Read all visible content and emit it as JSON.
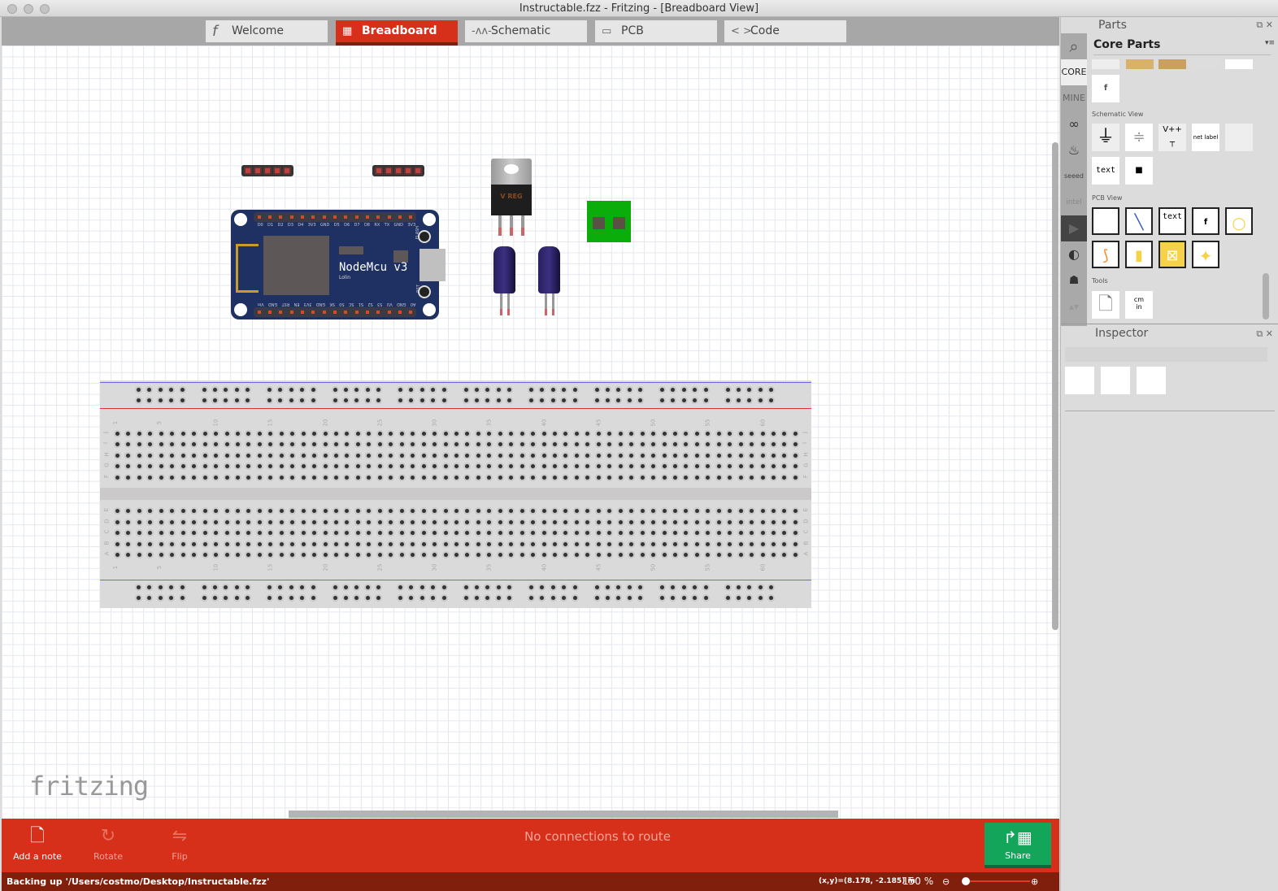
{
  "window": {
    "title": "Instructable.fzz - Fritzing - [Breadboard View]"
  },
  "tabs": [
    {
      "label": "Welcome",
      "icon": "fritzing-f-icon"
    },
    {
      "label": "Breadboard",
      "icon": "breadboard-icon",
      "active": true
    },
    {
      "label": "Schematic",
      "icon": "resistor-icon"
    },
    {
      "label": "PCB",
      "icon": "pcb-icon"
    },
    {
      "label": "Code",
      "icon": "code-icon"
    }
  ],
  "canvas": {
    "logo": "fritzing",
    "nodemcu": {
      "title": "NodeMcu v3",
      "subtitle": "Lolin",
      "flash": "FLASH",
      "rst": "RST",
      "top_pins": [
        "D0",
        "D1",
        "D2",
        "D3",
        "D4",
        "3V3",
        "GND",
        "D5",
        "D6",
        "D7",
        "D8",
        "RX",
        "TX",
        "GND",
        "3V3"
      ],
      "bottom_pins": [
        "A0",
        "GND",
        "VU",
        "S3",
        "S2",
        "S1",
        "SC",
        "S0",
        "SK",
        "GND",
        "3V3",
        "EN",
        "RST",
        "GND",
        "Vin"
      ]
    },
    "regulator_label": "V REG",
    "breadboard": {
      "top_rows": [
        "J",
        "I",
        "H",
        "G",
        "F"
      ],
      "bottom_rows": [
        "E",
        "D",
        "C",
        "B",
        "A"
      ],
      "column_labels": [
        "1",
        "5",
        "10",
        "15",
        "20",
        "25",
        "30",
        "35",
        "40",
        "45",
        "50",
        "55",
        "60"
      ]
    }
  },
  "toolbar": {
    "add_note": "Add a note",
    "rotate": "Rotate",
    "flip": "Flip",
    "routing_status": "No connections to route",
    "share": "Share"
  },
  "statusbar": {
    "message": "Backing up '/Users/costmo/Desktop/Instructable.fzz'",
    "coords": "(x,y)=(8.178, -2.185) in",
    "zoom": "150 %"
  },
  "parts_panel": {
    "title": "Parts",
    "bin_title": "Core Parts",
    "side_tabs": [
      "CORE",
      "MINE"
    ],
    "sections": {
      "schematic": "Schematic View",
      "pcb": "PCB View",
      "tools": "Tools"
    },
    "schematic_items": [
      "net label",
      "text"
    ],
    "pcb_items": [
      "text"
    ],
    "tool_items": [
      "cm",
      "in"
    ]
  },
  "inspector": {
    "title": "Inspector"
  },
  "colors": {
    "accent": "#d7301a",
    "share": "#13a55a",
    "status": "#7f1f0c"
  }
}
